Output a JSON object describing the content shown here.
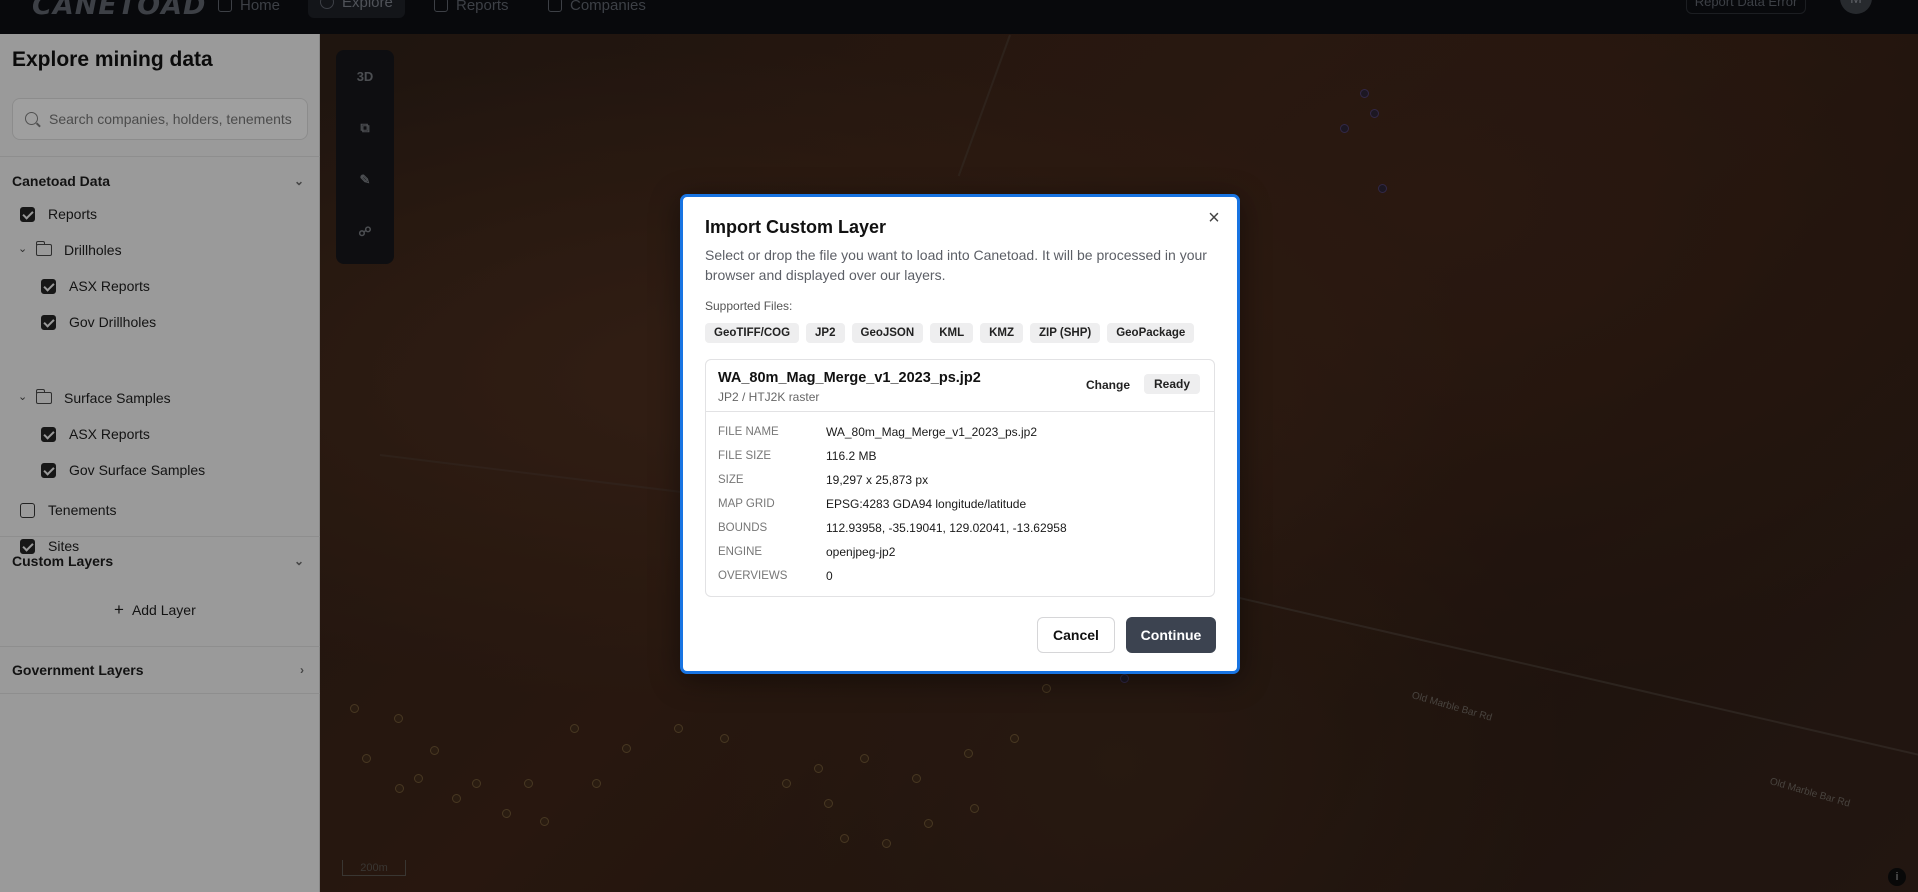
{
  "topnav": {
    "logo": "CANETOAD",
    "items": [
      {
        "label": "Home"
      },
      {
        "label": "Explore"
      },
      {
        "label": "Reports"
      },
      {
        "label": "Companies"
      }
    ],
    "report_button": "Report Data Error",
    "avatar": "M"
  },
  "sidebar": {
    "title": "Explore mining data",
    "search_placeholder": "Search companies, holders, tenements",
    "canetoad_section": "Canetoad Data",
    "tree": {
      "reports": "Reports",
      "drillholes": "Drillholes",
      "drill_asx": "ASX Reports",
      "drill_gov": "Gov Drillholes",
      "surface": "Surface Samples",
      "surface_asx": "ASX Reports",
      "surface_gov": "Gov Surface Samples",
      "tenements": "Tenements",
      "sites": "Sites"
    },
    "custom_section": "Custom Layers",
    "add_layer": "Add Layer",
    "government_section": "Government Layers"
  },
  "map": {
    "tools": [
      "3D"
    ],
    "scale": "200m",
    "road_labels": [
      "Old Marble Bar Rd",
      "Old Marble Bar Rd"
    ],
    "info": "i"
  },
  "modal": {
    "title": "Import Custom Layer",
    "description": "Select or drop the file you want to load into Canetoad. It will be processed in your browser and displayed over our layers.",
    "supported_label": "Supported Files:",
    "formats": [
      "GeoTIFF/COG",
      "JP2",
      "GeoJSON",
      "KML",
      "KMZ",
      "ZIP (SHP)",
      "GeoPackage"
    ],
    "file": {
      "name": "WA_80m_Mag_Merge_v1_2023_ps.jp2",
      "type": "JP2 / HTJ2K raster",
      "change_label": "Change",
      "status": "Ready",
      "details": [
        {
          "label": "File Name",
          "value": "WA_80m_Mag_Merge_v1_2023_ps.jp2"
        },
        {
          "label": "File Size",
          "value": "116.2 MB"
        },
        {
          "label": "Size",
          "value": "19,297 x 25,873 px"
        },
        {
          "label": "Map Grid",
          "value": "EPSG:4283 GDA94 longitude/latitude"
        },
        {
          "label": "Bounds",
          "value": "112.93958, -35.19041, 129.02041, -13.62958"
        },
        {
          "label": "Engine",
          "value": "openjpeg-jp2"
        },
        {
          "label": "Overviews",
          "value": "0"
        }
      ]
    },
    "cancel_label": "Cancel",
    "continue_label": "Continue"
  },
  "colors": {
    "accent": "#1874e2",
    "primary_button": "#3c4350"
  }
}
